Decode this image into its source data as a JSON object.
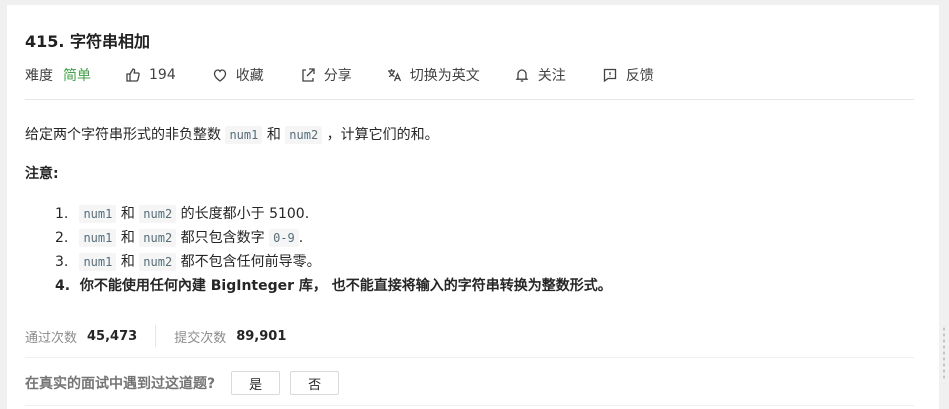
{
  "problem": {
    "title": "415. 字符串相加",
    "difficulty_label": "难度",
    "difficulty": "简单",
    "likes": "194",
    "collect_label": "收藏",
    "share_label": "分享",
    "switch_lang_label": "切换为英文",
    "follow_label": "关注",
    "feedback_label": "反馈"
  },
  "description": {
    "intro_before": "给定两个字符串形式的非负整数",
    "code_a": "num1",
    "and": "和",
    "code_b": "num2",
    "intro_after": "，计算它们的和。",
    "note_title": "注意:",
    "rules": [
      {
        "num": "1.",
        "a": "num1",
        "and": "和",
        "b": "num2",
        "text": "的长度都小于 5100."
      },
      {
        "num": "2.",
        "a": "num1",
        "and": "和",
        "b": "num2",
        "text": "都只包含数字",
        "code": "0-9",
        "tail": "."
      },
      {
        "num": "3.",
        "a": "num1",
        "and": "和",
        "b": "num2",
        "text": "都不包含任何前导零。"
      },
      {
        "num": "4.",
        "text": "你不能使用任何內建 BigInteger 库， 也不能直接将输入的字符串转换为整数形式。"
      }
    ]
  },
  "stats": {
    "accepted_label": "通过次数",
    "accepted": "45,473",
    "submitted_label": "提交次数",
    "submitted": "89,901"
  },
  "survey": {
    "question": "在真实的面试中遇到过这道题?",
    "yes": "是",
    "no": "否"
  },
  "colors": {
    "difficulty_easy": "#43a047",
    "code_bg": "#f5f5f5",
    "code_text": "#546e7a"
  }
}
